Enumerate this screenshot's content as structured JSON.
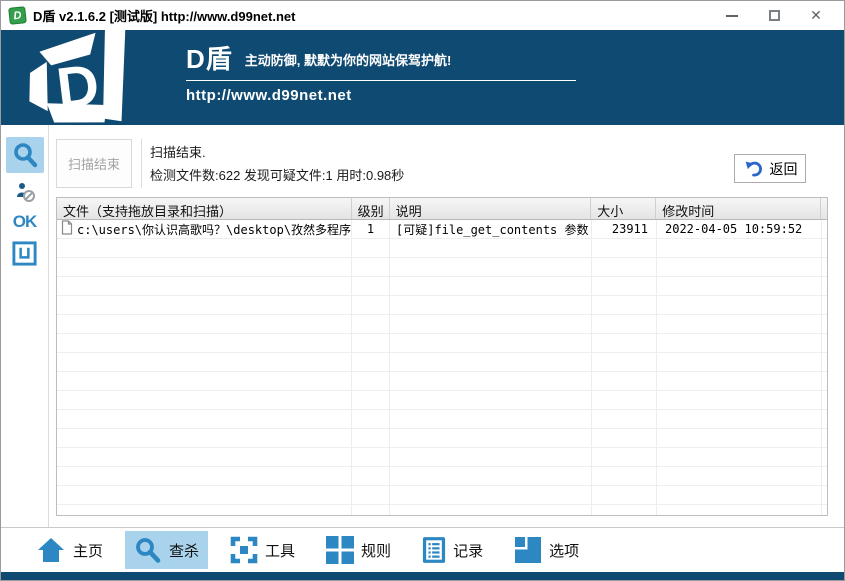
{
  "titlebar": {
    "icon_letter": "D",
    "title": "D盾 v2.1.6.2 [测试版] http://www.d99net.net"
  },
  "banner": {
    "logo_letter": "D",
    "brand": "D盾",
    "slogan": "主动防御, 默默为你的网站保驾护航!",
    "url": "http://www.d99net.net"
  },
  "sidebar": {
    "ok_label": "OK",
    "icons": [
      "magnifier-icon",
      "no-trojan-icon",
      "ok-label",
      "square-u-icon"
    ]
  },
  "scan": {
    "button_label": "扫描结束",
    "status_line1": "扫描结束.",
    "status_line2": "检测文件数:622 发现可疑文件:1 用时:0.98秒",
    "back_label": "返回"
  },
  "table": {
    "columns": [
      "文件（支持拖放目录和扫描）",
      "级别",
      "说明",
      "大小",
      "修改时间"
    ],
    "rows": [
      {
        "file": "c:\\users\\你认识高歌吗？\\desktop\\孜然多程序...",
        "level": "1",
        "desc": "[可疑]file_get_contents 参数...",
        "size": "23911",
        "mtime": "2022-04-05 10:59:52"
      }
    ],
    "empty_rows": 15
  },
  "toolbar": {
    "items": [
      {
        "id": "home",
        "label": "主页",
        "icon": "home-icon",
        "active": false
      },
      {
        "id": "scan",
        "label": "查杀",
        "icon": "scan-icon",
        "active": true
      },
      {
        "id": "tools",
        "label": "工具",
        "icon": "tools-icon",
        "active": false
      },
      {
        "id": "rules",
        "label": "规则",
        "icon": "rules-icon",
        "active": false
      },
      {
        "id": "logs",
        "label": "记录",
        "icon": "log-icon",
        "active": false
      },
      {
        "id": "options",
        "label": "选项",
        "icon": "options-icon",
        "active": false
      }
    ]
  },
  "colors": {
    "accent_blue": "#2d87c3",
    "highlight_blue": "#a9d2ec",
    "banner_navy": "#0e4a72",
    "back_arrow_blue": "#2b65c8",
    "titlebar_icon_green": "#34a04b"
  }
}
